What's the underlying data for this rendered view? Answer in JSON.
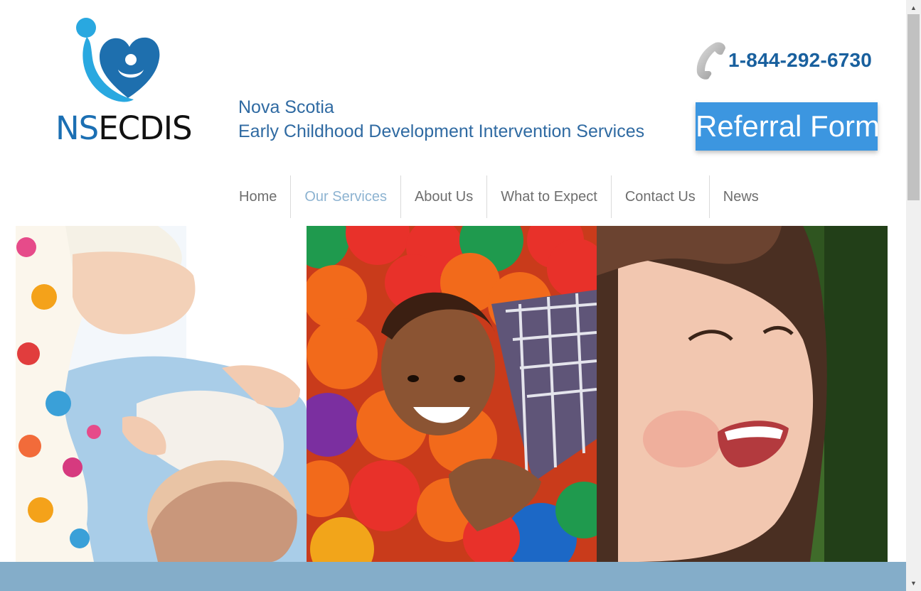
{
  "logo": {
    "prefix": "NS",
    "rest": "ECDIS"
  },
  "tagline": {
    "line1": "Nova Scotia",
    "line2": "Early Childhood Development Intervention Services"
  },
  "contact": {
    "phone": "1-844-292-6730"
  },
  "cta": {
    "referral_label": "Referral Form"
  },
  "nav": {
    "home": "Home",
    "services": "Our Services",
    "about": "About Us",
    "expect": "What to Expect",
    "contact": "Contact Us",
    "news": "News"
  },
  "colors": {
    "brand_blue": "#1b6fb3",
    "button_blue": "#3c96e0",
    "nav_active": "#8db3d1",
    "band": "#84adc9"
  },
  "icons": {
    "phone": "phone-handset-icon",
    "logo_mark": "heart-figure-logo-icon"
  }
}
